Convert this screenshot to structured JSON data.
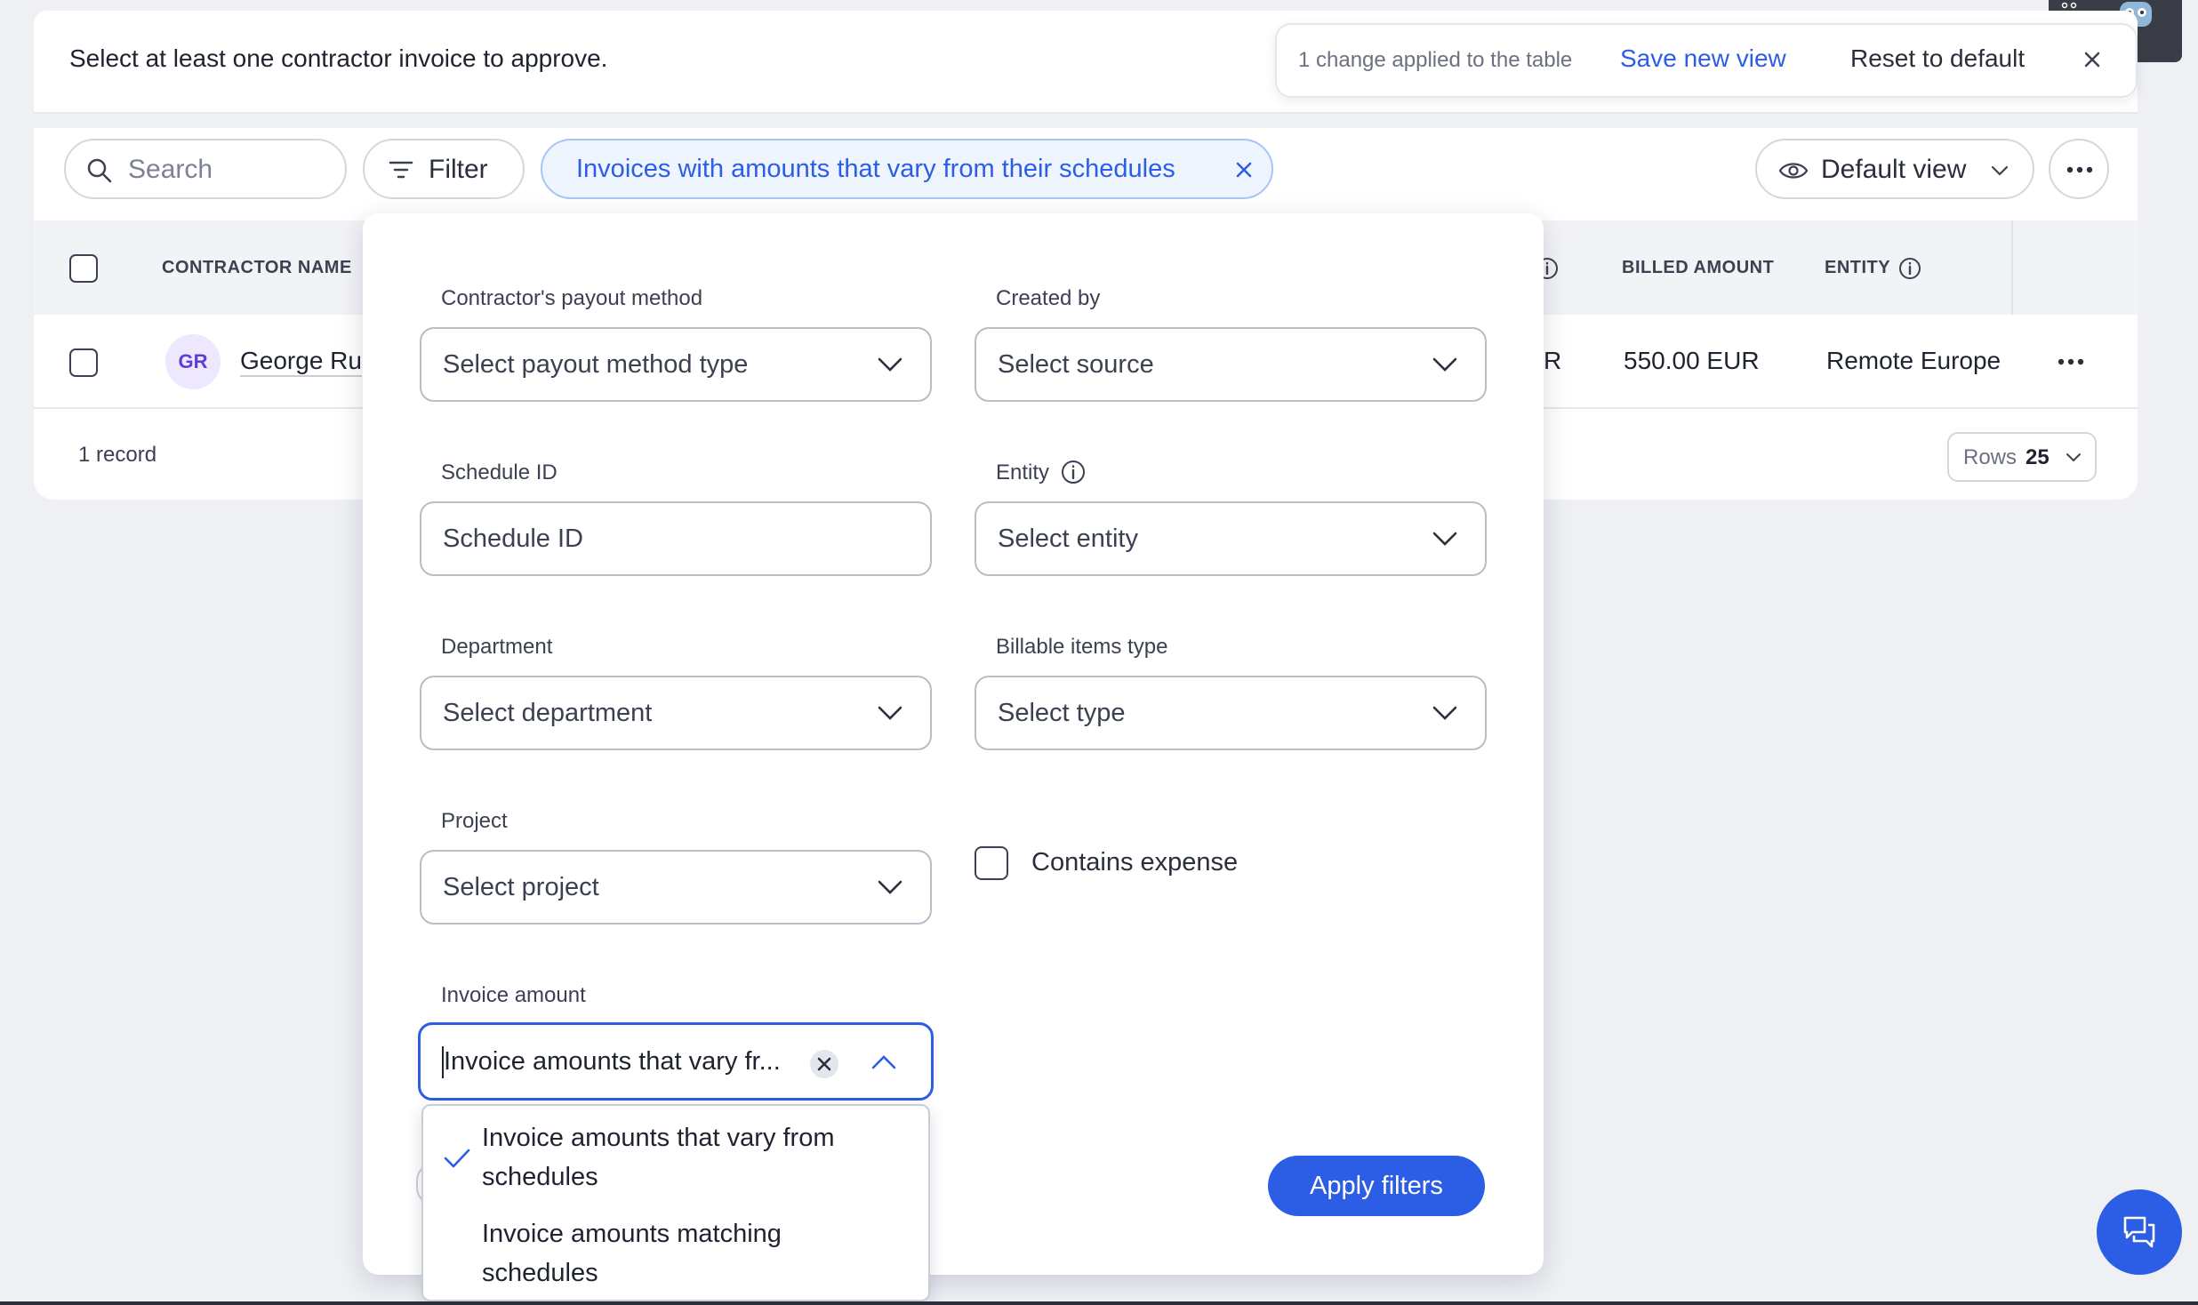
{
  "banner": {
    "message": "Select at least one contractor invoice to approve."
  },
  "changes_popup": {
    "text": "1 change applied to the table",
    "save_label": "Save new view",
    "reset_label": "Reset to default"
  },
  "toolbar": {
    "search_placeholder": "Search",
    "filter_label": "Filter",
    "active_chip": "Invoices with amounts that vary from their schedules",
    "view_label": "Default view"
  },
  "table": {
    "columns": {
      "contractor_name": "CONTRACTOR NAME",
      "billed_amount": "BILLED AMOUNT",
      "entity": "ENTITY"
    },
    "rows": [
      {
        "initials": "GR",
        "name": "George Ru",
        "partial": "R",
        "billed_amount": "550.00 EUR",
        "entity": "Remote Europe"
      }
    ],
    "footer": {
      "records": "1 record",
      "rows_label": "Rows",
      "rows_value": "25"
    }
  },
  "filters": {
    "payout_method": {
      "label": "Contractor's payout method",
      "placeholder": "Select payout method type"
    },
    "created_by": {
      "label": "Created by",
      "placeholder": "Select source"
    },
    "schedule_id": {
      "label": "Schedule ID",
      "placeholder": "Schedule ID"
    },
    "entity": {
      "label": "Entity",
      "placeholder": "Select entity"
    },
    "department": {
      "label": "Department",
      "placeholder": "Select department"
    },
    "billable_items": {
      "label": "Billable items type",
      "placeholder": "Select type"
    },
    "project": {
      "label": "Project",
      "placeholder": "Select project"
    },
    "contains_expense": {
      "label": "Contains expense",
      "checked": false
    },
    "invoice_amount": {
      "label": "Invoice amount",
      "value": "Invoice amounts that vary fr...",
      "options": [
        {
          "line1": "Invoice amounts that vary from",
          "line2": "schedules",
          "selected": true
        },
        {
          "line1": "Invoice amounts matching",
          "line2": "schedules",
          "selected": false
        }
      ]
    },
    "apply_label": "Apply filters"
  },
  "colors": {
    "accent": "#2c5de5",
    "chip_bg": "#eef5ff",
    "avatar_bg": "#ede8fd"
  }
}
